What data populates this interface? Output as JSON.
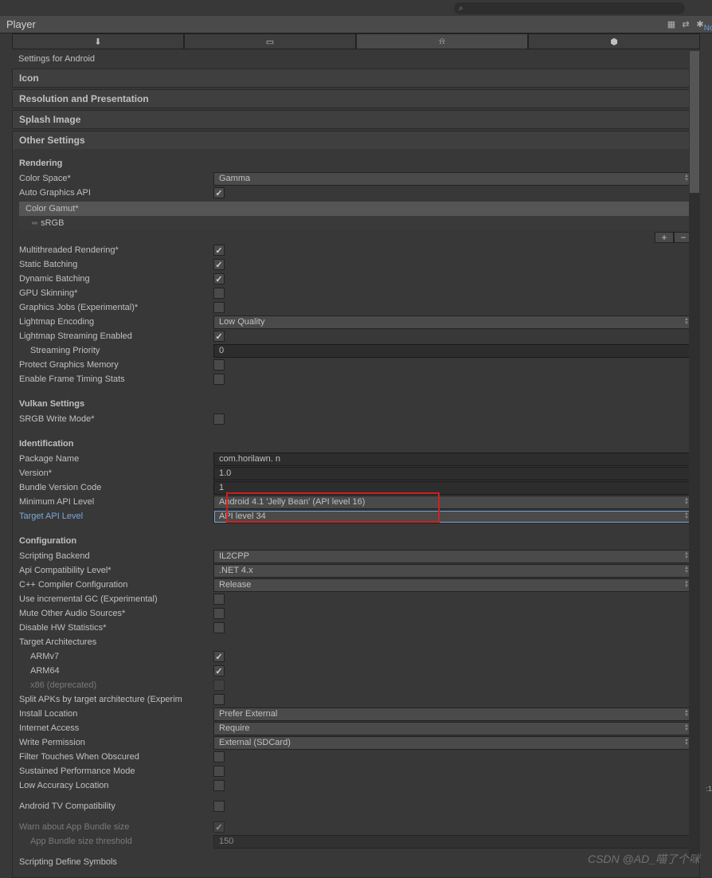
{
  "search": {
    "placeholder": ""
  },
  "panel": {
    "title": "Player"
  },
  "platforms": [
    "download",
    "standalone",
    "android",
    "webgl"
  ],
  "settingsFor": "Settings for Android",
  "sections": {
    "icon": "Icon",
    "resolution": "Resolution and Presentation",
    "splash": "Splash Image",
    "other": "Other Settings"
  },
  "rendering": {
    "header": "Rendering",
    "colorSpace": {
      "label": "Color Space*",
      "value": "Gamma"
    },
    "autoGraphics": {
      "label": "Auto Graphics API",
      "checked": true
    },
    "colorGamut": {
      "label": "Color Gamut*",
      "item": "sRGB"
    },
    "multithreaded": {
      "label": "Multithreaded Rendering*",
      "checked": true
    },
    "staticBatch": {
      "label": "Static Batching",
      "checked": true
    },
    "dynamicBatch": {
      "label": "Dynamic Batching",
      "checked": true
    },
    "gpuSkin": {
      "label": "GPU Skinning*",
      "checked": false
    },
    "graphicsJobs": {
      "label": "Graphics Jobs (Experimental)*",
      "checked": false
    },
    "lightmapEnc": {
      "label": "Lightmap Encoding",
      "value": "Low Quality"
    },
    "lightmapStream": {
      "label": "Lightmap Streaming Enabled",
      "checked": true
    },
    "streamPriority": {
      "label": "Streaming Priority",
      "value": "0"
    },
    "protectMem": {
      "label": "Protect Graphics Memory",
      "checked": false
    },
    "frameTiming": {
      "label": "Enable Frame Timing Stats",
      "checked": false
    }
  },
  "vulkan": {
    "header": "Vulkan Settings",
    "srgbWrite": {
      "label": "SRGB Write Mode*",
      "checked": false
    }
  },
  "identification": {
    "header": "Identification",
    "packageName": {
      "label": "Package Name",
      "value": "com.horilawn.        n"
    },
    "version": {
      "label": "Version*",
      "value": "1.0"
    },
    "bundleCode": {
      "label": "Bundle Version Code",
      "value": "1"
    },
    "minApi": {
      "label": "Minimum API Level",
      "value": "Android 4.1 'Jelly Bean' (API level 16)"
    },
    "targetApi": {
      "label": "Target API Level",
      "value": "API level 34"
    }
  },
  "configuration": {
    "header": "Configuration",
    "scriptBackend": {
      "label": "Scripting Backend",
      "value": "IL2CPP"
    },
    "apiCompat": {
      "label": "Api Compatibility Level*",
      "value": ".NET 4.x"
    },
    "cppConfig": {
      "label": "C++ Compiler Configuration",
      "value": "Release"
    },
    "incrGC": {
      "label": "Use incremental GC (Experimental)",
      "checked": false
    },
    "muteAudio": {
      "label": "Mute Other Audio Sources*",
      "checked": false
    },
    "disableHW": {
      "label": "Disable HW Statistics*",
      "checked": false
    },
    "targetArch": {
      "label": "Target Architectures"
    },
    "armv7": {
      "label": "ARMv7",
      "checked": true
    },
    "arm64": {
      "label": "ARM64",
      "checked": true
    },
    "x86": {
      "label": "x86 (deprecated)",
      "checked": false
    },
    "splitApk": {
      "label": "Split APKs by target architecture (Experim",
      "checked": false
    },
    "installLoc": {
      "label": "Install Location",
      "value": "Prefer External"
    },
    "internet": {
      "label": "Internet Access",
      "value": "Require"
    },
    "writePerm": {
      "label": "Write Permission",
      "value": "External (SDCard)"
    },
    "filterTouch": {
      "label": "Filter Touches When Obscured",
      "checked": false
    },
    "sustainedPerf": {
      "label": "Sustained Performance Mode",
      "checked": false
    },
    "lowAccLoc": {
      "label": "Low Accuracy Location",
      "checked": false
    },
    "androidTV": {
      "label": "Android TV Compatibility",
      "checked": false
    },
    "warnBundle": {
      "label": "Warn about App Bundle size",
      "checked": true
    },
    "bundleThreshold": {
      "label": "App Bundle size threshold",
      "value": "150"
    },
    "scriptDefine": {
      "label": "Scripting Define Symbols"
    }
  },
  "watermark": "CSDN @AD_喵了个咪",
  "rt": ":1"
}
